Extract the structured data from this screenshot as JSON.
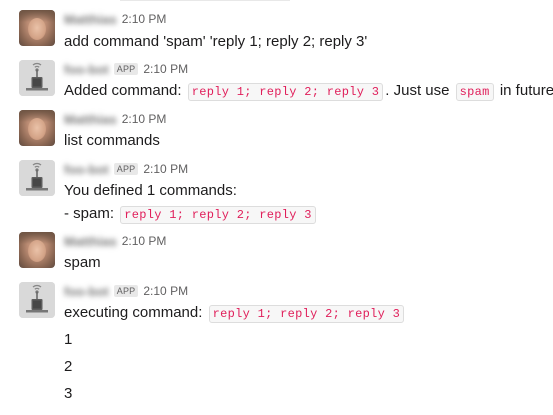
{
  "user": {
    "name": "Matthias"
  },
  "bot": {
    "name": "foo-bot",
    "badge": "APP"
  },
  "messages": {
    "m1": {
      "time": "2:10 PM",
      "text": "add command 'spam' 'reply 1; reply 2; reply 3'"
    },
    "m2": {
      "time": "2:10 PM",
      "prefix": "Added command:",
      "code1": "reply 1; reply 2; reply 3",
      "middle": ". Just use",
      "code2": "spam",
      "suffix": "in future."
    },
    "m3": {
      "time": "2:10 PM",
      "text": "list commands"
    },
    "m4": {
      "time": "2:10 PM",
      "line1": "You defined 1 commands:",
      "line2_prefix": "- spam:",
      "code": "reply 1; reply 2; reply 3"
    },
    "m5": {
      "time": "2:10 PM",
      "text": "spam"
    },
    "m6": {
      "time": "2:10 PM",
      "prefix": "executing command:",
      "code": "reply 1; reply 2; reply 3",
      "replies": [
        "1",
        "2",
        "3"
      ]
    }
  },
  "icons": {
    "user_avatar": "person-avatar",
    "bot_avatar": "robot-antenna-avatar"
  }
}
